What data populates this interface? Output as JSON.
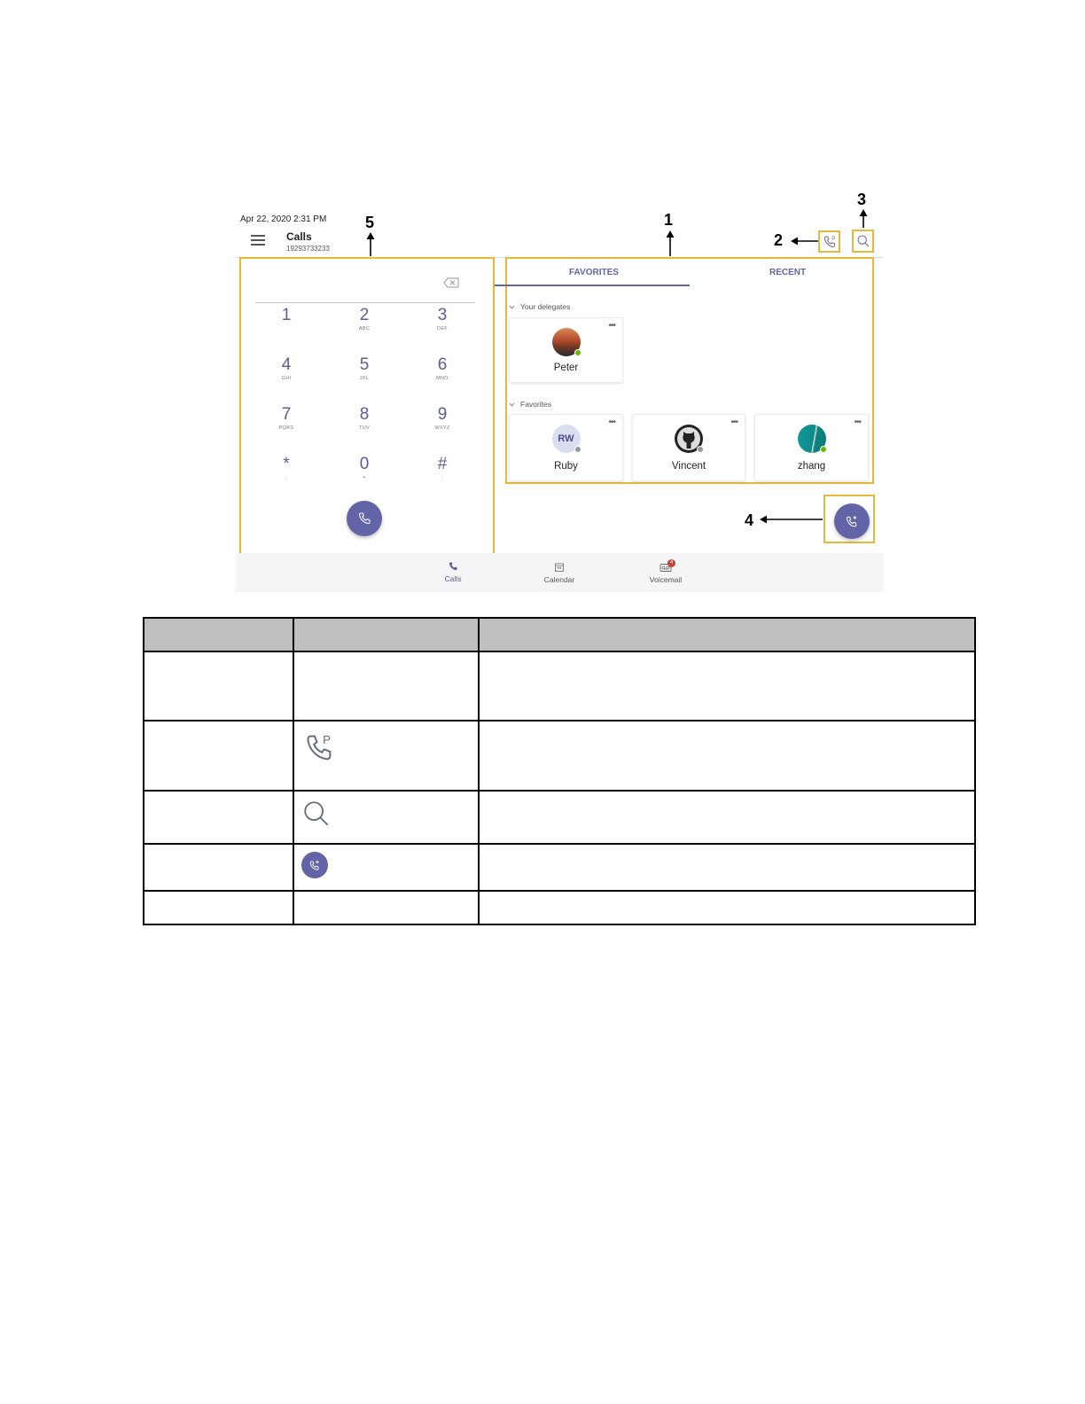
{
  "status_bar": {
    "datetime": "Apr 22, 2020   2:31 PM"
  },
  "header": {
    "title": "Calls",
    "number": "19293733233"
  },
  "callouts": [
    "1",
    "2",
    "3",
    "4",
    "5"
  ],
  "dialpad": {
    "keys": [
      {
        "digit": "1",
        "letters": ""
      },
      {
        "digit": "2",
        "letters": "ABC"
      },
      {
        "digit": "3",
        "letters": "DEF"
      },
      {
        "digit": "4",
        "letters": "GHI"
      },
      {
        "digit": "5",
        "letters": "JKL"
      },
      {
        "digit": "6",
        "letters": "MNO"
      },
      {
        "digit": "7",
        "letters": "PQRS"
      },
      {
        "digit": "8",
        "letters": "TUV"
      },
      {
        "digit": "9",
        "letters": "WXYZ"
      },
      {
        "digit": "*",
        "letters": ","
      },
      {
        "digit": "0",
        "letters": "+"
      },
      {
        "digit": "#",
        "letters": ";"
      }
    ]
  },
  "tabs": {
    "favorites": "FAVORITES",
    "recent": "RECENT"
  },
  "sections": {
    "delegates": "Your delegates",
    "favorites": "Favorites"
  },
  "contacts": {
    "peter": {
      "name": "Peter"
    },
    "ruby": {
      "name": "Ruby",
      "initials": "RW"
    },
    "vincent": {
      "name": "Vincent"
    },
    "zhang": {
      "name": "zhang"
    }
  },
  "bottom_nav": {
    "calls": "Calls",
    "calendar": "Calendar",
    "voicemail": "Voicemail",
    "voicemail_badge": "4"
  },
  "colors": {
    "accent": "#6264a7",
    "highlight": "#e5b93a",
    "presence_available": "#6bb700",
    "presence_offline": "#999999",
    "table_header": "#bfbfbf"
  },
  "icons": [
    "menu-icon",
    "backspace-icon",
    "phone-icon",
    "park-call-icon",
    "search-icon",
    "add-call-icon",
    "calendar-icon",
    "voicemail-icon"
  ]
}
